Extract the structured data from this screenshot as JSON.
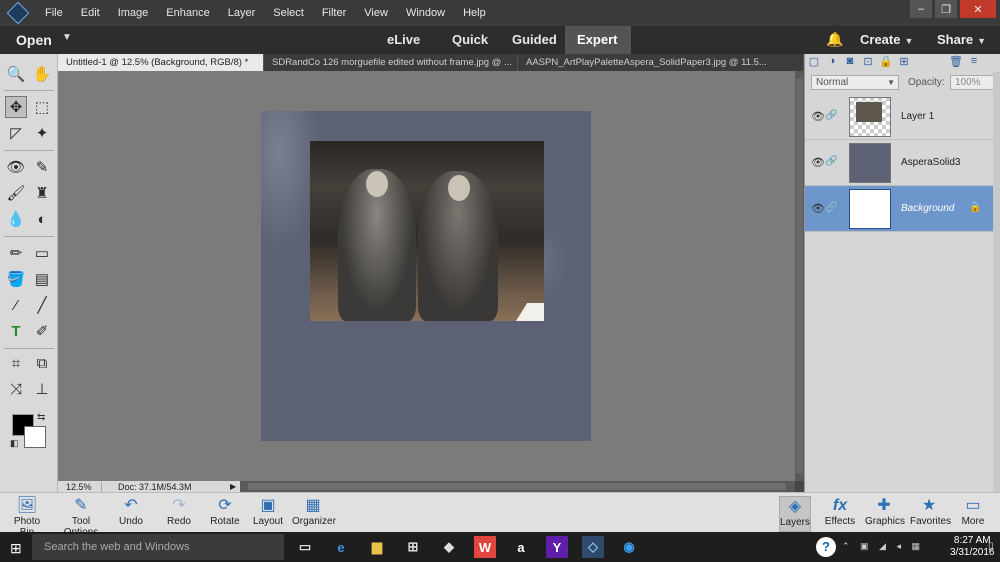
{
  "menu": [
    "File",
    "Edit",
    "Image",
    "Enhance",
    "Layer",
    "Select",
    "Filter",
    "View",
    "Window",
    "Help"
  ],
  "window_controls": {
    "minimize": "–",
    "restore": "❐",
    "close": "✕"
  },
  "modebar": {
    "open_label": "Open",
    "modes": [
      "eLive",
      "Quick",
      "Guided",
      "Expert"
    ],
    "active_mode": "Expert",
    "create_label": "Create",
    "share_label": "Share"
  },
  "doc_tabs": [
    "Untitled-1 @ 12.5% (Background, RGB/8) *",
    "SDRandCo 126 morguefile edited without frame.jpg @ ...",
    "AASPN_ArtPlayPaletteAspera_SolidPaper3.jpg @ 11.5..."
  ],
  "status": {
    "zoom": "12.5%",
    "doc": "Doc: 37.1M/54.3M"
  },
  "layers_panel": {
    "blend_mode": "Normal",
    "opacity_label": "Opacity:",
    "opacity_value": "100%",
    "layers": [
      {
        "name": "Layer 1",
        "thumb_color": "#6b645a",
        "selected": false
      },
      {
        "name": "AsperaSolid3",
        "thumb_color": "#5c6273",
        "selected": false
      },
      {
        "name": "Background",
        "thumb_color": "#ffffff",
        "selected": true
      }
    ]
  },
  "bottom_bar": {
    "left": [
      {
        "label": "Photo Bin",
        "icon": "photo-bin-icon"
      },
      {
        "label": "Tool Options",
        "icon": "tool-options-icon"
      },
      {
        "label": "Undo",
        "icon": "undo-icon"
      },
      {
        "label": "Redo",
        "icon": "redo-icon"
      },
      {
        "label": "Rotate",
        "icon": "rotate-icon"
      },
      {
        "label": "Layout",
        "icon": "layout-icon"
      },
      {
        "label": "Organizer",
        "icon": "organizer-icon"
      }
    ],
    "right": [
      {
        "label": "Layers",
        "icon": "layers-icon"
      },
      {
        "label": "Effects",
        "icon": "effects-icon"
      },
      {
        "label": "Graphics",
        "icon": "graphics-icon"
      },
      {
        "label": "Favorites",
        "icon": "favorites-icon"
      },
      {
        "label": "More",
        "icon": "more-icon"
      }
    ]
  },
  "windows": {
    "search_placeholder": "Search the web and Windows",
    "time": "8:27 AM",
    "date": "3/31/2016"
  },
  "colors": {
    "accent": "#6d97cc",
    "paper": "#5c6273",
    "canvas_bg": "#7b7b7b"
  }
}
